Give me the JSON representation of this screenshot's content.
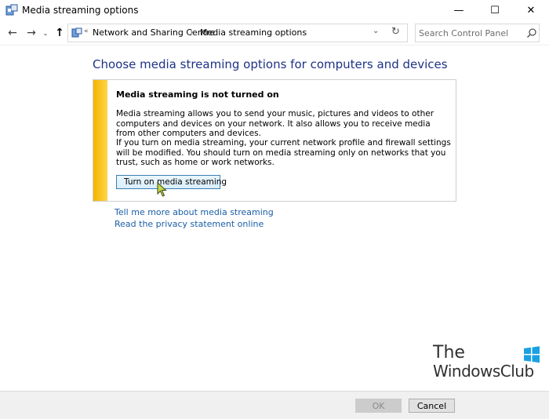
{
  "window": {
    "title": "Media streaming options",
    "controls": {
      "minimize": "—",
      "maximize": "☐",
      "close": "✕"
    }
  },
  "nav": {
    "back": "←",
    "forward": "→",
    "recent": "⌄",
    "up": "↑",
    "overflow": "«",
    "breadcrumbs": [
      "Network and Sharing Centre",
      "Media streaming options"
    ],
    "separator": "›",
    "dropdown": "⌄",
    "refresh": "↻",
    "search_placeholder": "Search Control Panel"
  },
  "main": {
    "heading": "Choose media streaming options for computers and devices",
    "infobox": {
      "title": "Media streaming is not turned on",
      "paragraph1": "Media streaming allows you to send your music, pictures and videos to other computers and devices on your network.  It also allows you to receive media from other computers and devices.",
      "paragraph2": "If you turn on media streaming, your current network profile and firewall settings will be modified. You should turn on media streaming only on networks that you trust, such as home or work networks.",
      "button_label": "Turn on media streaming"
    },
    "links": [
      "Tell me more about media streaming",
      "Read the privacy statement online"
    ]
  },
  "watermark": {
    "line1": "The",
    "line2": "WindowsClub"
  },
  "footer": {
    "ok_label": "OK",
    "cancel_label": "Cancel"
  },
  "colors": {
    "heading": "#1e3287",
    "link": "#1a5ea8",
    "stripe": "#f4b400",
    "button_border": "#3c7fb1"
  },
  "icons": [
    "media-streaming-app-icon",
    "shield-icon",
    "search-icon",
    "cursor-icon",
    "windows-club-logo-icon"
  ]
}
